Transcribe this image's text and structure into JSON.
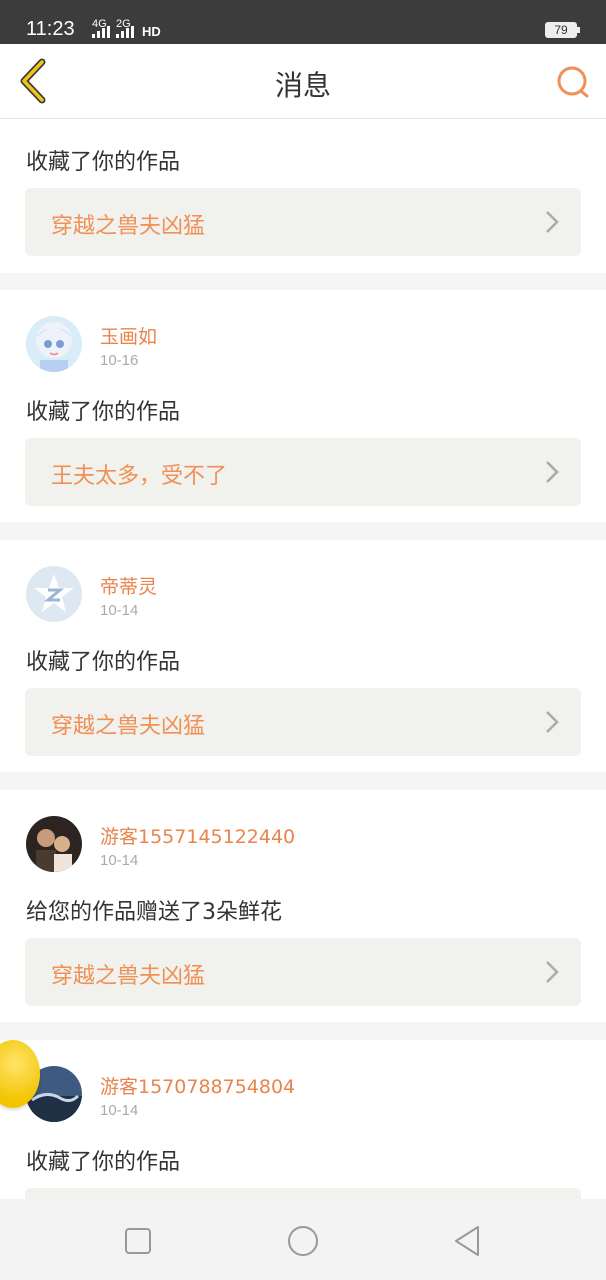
{
  "status_bar": {
    "time": "11:23",
    "signal1": "4G",
    "signal2": "2G",
    "hd": "HD",
    "battery": "79"
  },
  "header": {
    "title": "消息"
  },
  "messages": [
    {
      "user": "",
      "date": "",
      "action": "收藏了你的作品",
      "work_title": "穿越之兽夫凶猛",
      "avatar": "avatar-icon"
    },
    {
      "user": "玉画如",
      "date": "10-16",
      "action": "收藏了你的作品",
      "work_title": "王夫太多，受不了",
      "avatar": "anime-girl-avatar"
    },
    {
      "user": "帝蒂灵",
      "date": "10-14",
      "action": "收藏了你的作品",
      "work_title": "穿越之兽夫凶猛",
      "avatar": "qzone-star-avatar"
    },
    {
      "user": "游客1557145122440",
      "date": "10-14",
      "action": "给您的作品赠送了3朵鲜花",
      "work_title": "穿越之兽夫凶猛",
      "avatar": "photo-avatar"
    },
    {
      "user": "游客1570788754804",
      "date": "10-14",
      "action": "收藏了你的作品",
      "work_title": "",
      "avatar": "photo-avatar"
    }
  ],
  "colors": {
    "accent": "#e9844c",
    "work_bg": "#f1f1ed",
    "header_back": "#d4a017"
  }
}
